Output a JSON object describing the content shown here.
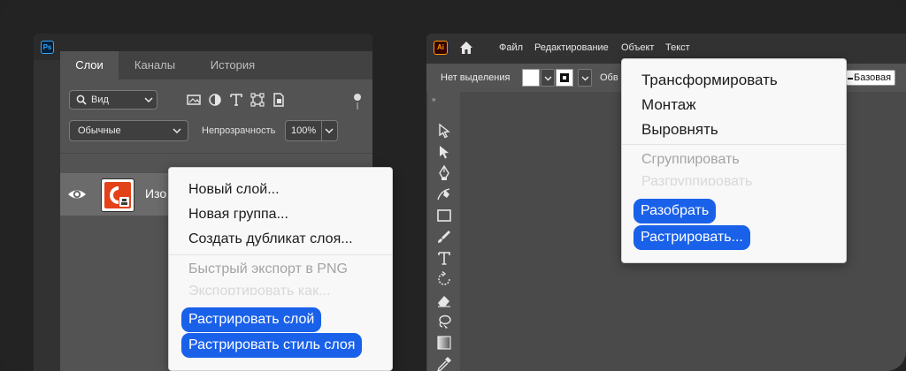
{
  "photoshop": {
    "logo": "Ps",
    "tabs": [
      "Слои",
      "Каналы",
      "История"
    ],
    "active_tab": "Слои",
    "search_label": "Вид",
    "blend_mode": "Обычные",
    "opacity_label": "Непрозрачность",
    "opacity_value": "100%",
    "layer_name": "Изо",
    "context_menu": {
      "items": [
        {
          "label": "Новый слой...",
          "state": "enabled"
        },
        {
          "label": "Новая группа...",
          "state": "enabled"
        },
        {
          "label": "Создать дубликат слоя...",
          "state": "enabled"
        },
        {
          "label": "Быстрый экспорт в PNG",
          "state": "disabled"
        },
        {
          "label": "Экспортировать как...",
          "state": "faded"
        }
      ],
      "highlighted": [
        "Растрировать слой",
        "Растрировать стиль слоя"
      ]
    }
  },
  "illustrator": {
    "logo": "Ai",
    "menu": [
      "Файл",
      "Редактирование",
      "Объект",
      "Текст"
    ],
    "control_bar": {
      "selection_label": "Нет выделения",
      "stroke_label": "Обв",
      "profile_label": "Базовая"
    },
    "context_menu": {
      "items": [
        {
          "label": "Трансформировать",
          "state": "enabled"
        },
        {
          "label": "Монтаж",
          "state": "enabled"
        },
        {
          "label": "Выровнять",
          "state": "enabled"
        },
        {
          "label": "Сгруппировать",
          "state": "disabled"
        },
        {
          "label": "Разгруппировать",
          "state": "faded"
        }
      ],
      "highlighted": [
        "Разобрать",
        "Растрировать..."
      ]
    }
  },
  "colors": {
    "highlight": "#1a61ea",
    "ps_accent": "#31a8ff",
    "ai_accent": "#ff9a00",
    "layer_thumb": "#e34219"
  }
}
